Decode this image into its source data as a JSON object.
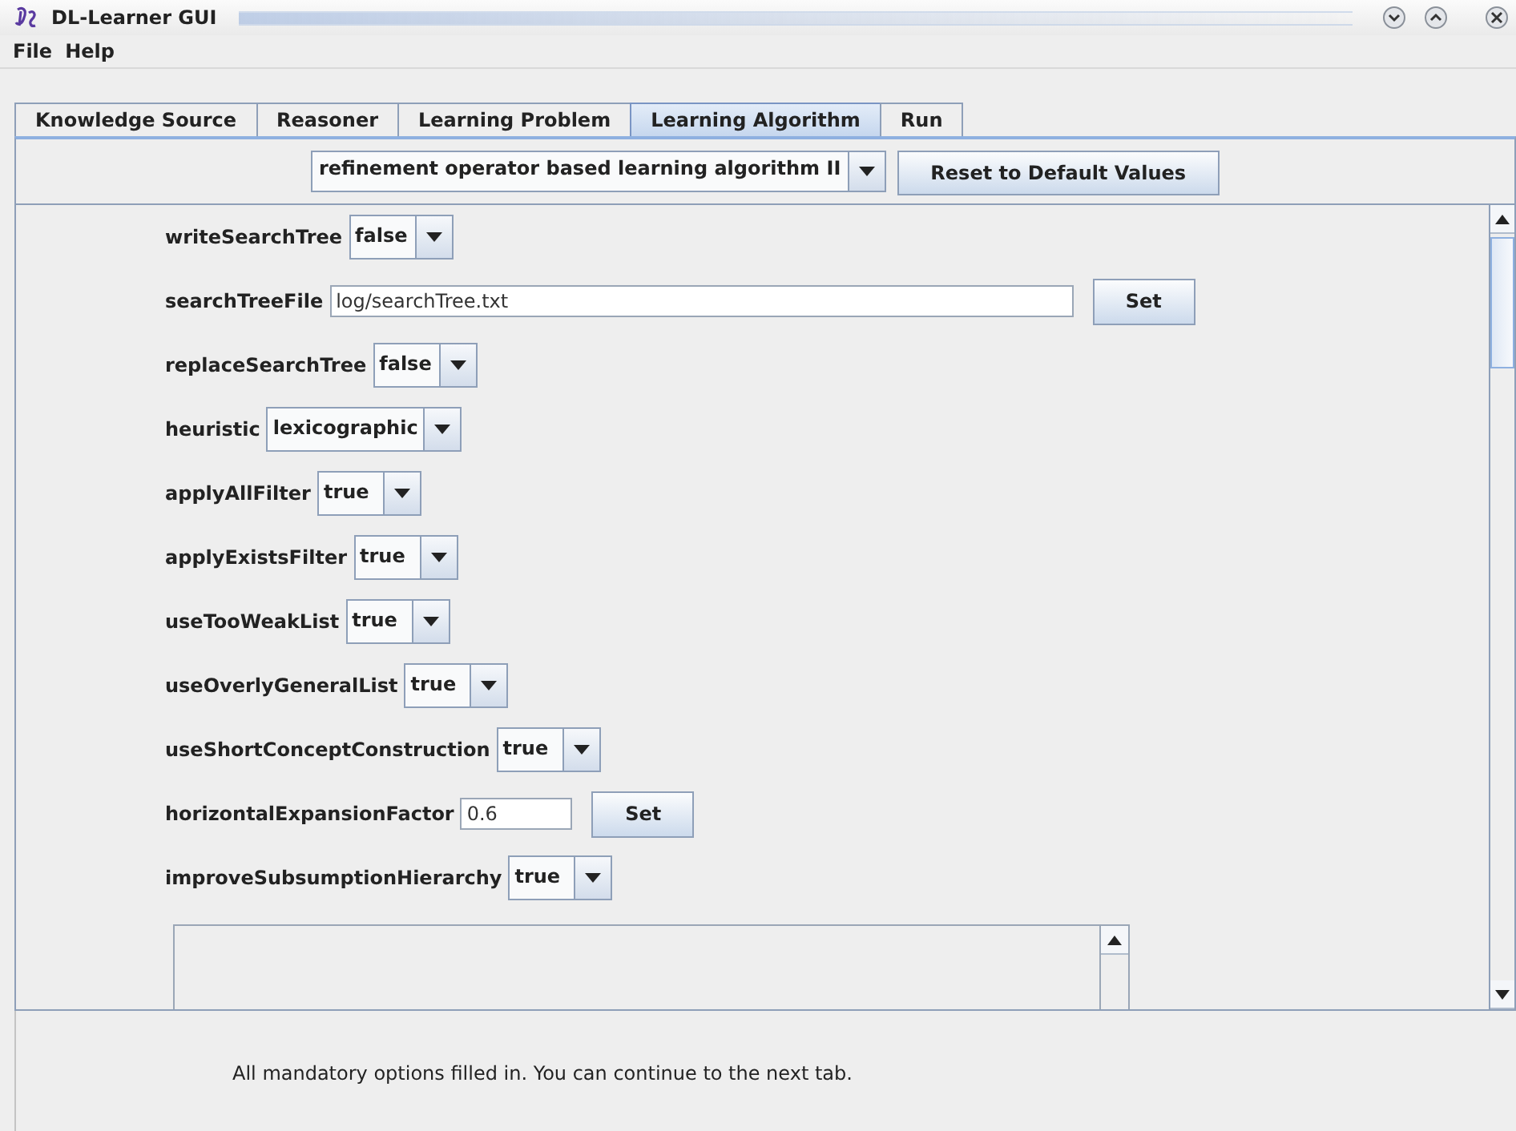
{
  "window": {
    "title": "DL-Learner GUI"
  },
  "menu": [
    "File",
    "Help"
  ],
  "tabs": [
    {
      "label": "Knowledge Source",
      "selected": false
    },
    {
      "label": "Reasoner",
      "selected": false
    },
    {
      "label": "Learning Problem",
      "selected": false
    },
    {
      "label": "Learning Algorithm",
      "selected": true
    },
    {
      "label": "Run",
      "selected": false
    }
  ],
  "algorithm": {
    "value": "refinement operator based learning algorithm II"
  },
  "reset_button": "Reset to Default Values",
  "options": [
    {
      "kind": "combo",
      "label": "writeSearchTree",
      "value": "false"
    },
    {
      "kind": "text",
      "label": "searchTreeFile",
      "value": "log/searchTree.txt",
      "button": "Set"
    },
    {
      "kind": "combo",
      "label": "replaceSearchTree",
      "value": "false"
    },
    {
      "kind": "combo",
      "label": "heuristic",
      "value": "lexicographic"
    },
    {
      "kind": "combo",
      "label": "applyAllFilter",
      "value": "true"
    },
    {
      "kind": "combo",
      "label": "applyExistsFilter",
      "value": "true"
    },
    {
      "kind": "combo",
      "label": "useTooWeakList",
      "value": "true"
    },
    {
      "kind": "combo",
      "label": "useOverlyGeneralList",
      "value": "true"
    },
    {
      "kind": "combo",
      "label": "useShortConceptConstruction",
      "value": "true"
    },
    {
      "kind": "text",
      "label": "horizontalExpansionFactor",
      "value": "0.6",
      "button": "Set"
    },
    {
      "kind": "combo",
      "label": "improveSubsumptionHierarchy",
      "value": "true"
    }
  ],
  "status": "All mandatory options filled in. You can continue to the next tab."
}
